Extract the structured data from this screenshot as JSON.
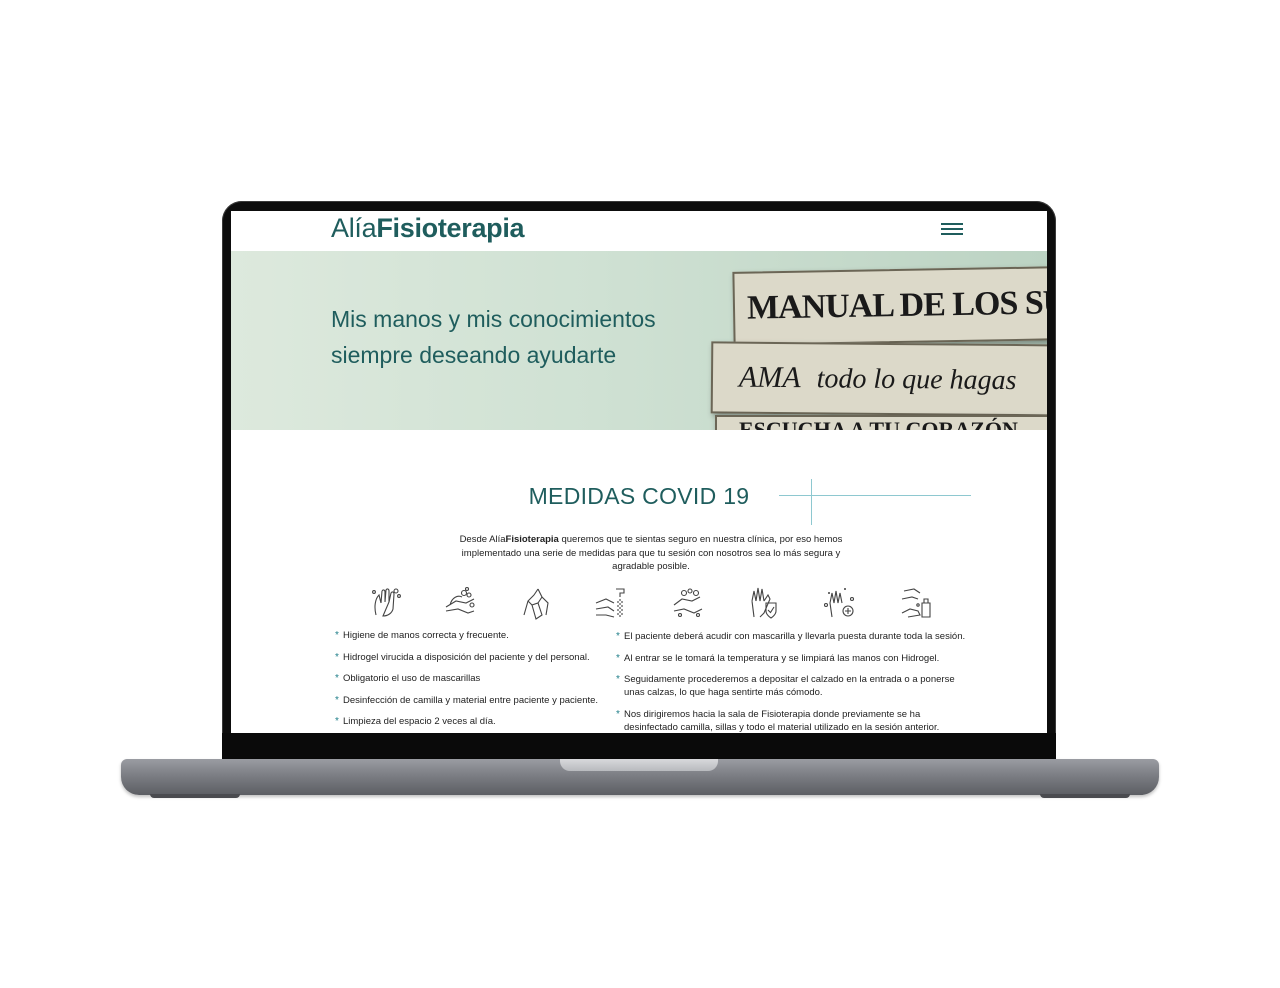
{
  "site": {
    "logo_light": "Alía",
    "logo_bold": "Fisioterapia",
    "menu_icon": "hamburger-menu-icon"
  },
  "hero": {
    "tagline_line1": "Mis manos y mis conocimientos",
    "tagline_line2": "siempre deseando ayudarte",
    "sign_line1": "MANUAL DE LOS SUEÑOS",
    "sign_line2_big": "AMA",
    "sign_line2_small": "todo lo que hagas",
    "sign_line3": "ESCUCHA A TU CORAZÓN"
  },
  "covid": {
    "title": "MEDIDAS COVID 19",
    "intro_before": "Desde Alía",
    "intro_bold": "Fisioterapia",
    "intro_after": " queremos que te sientas seguro en nuestra clínica, por eso hemos implementado una serie de medidas para que tu sesión con nosotros sea lo más segura y agradable posible.",
    "icons": [
      "hand-wash-icon",
      "soap-hands-icon",
      "tissue-hands-icon",
      "faucet-hands-icon",
      "rinse-hands-icon",
      "hand-shield-icon",
      "sanitize-hands-icon",
      "dispenser-hand-icon"
    ],
    "left_items": [
      "Higiene de manos correcta y frecuente.",
      "Hidrogel virucida a disposición del paciente y del personal.",
      "Obligatorio el uso de mascarillas",
      "Desinfección de camilla y material entre paciente y paciente.",
      "Limpieza del espacio 2 veces al día."
    ],
    "right_items": [
      "El paciente deberá acudir con mascarilla y llevarla puesta durante toda la sesión.",
      "Al entrar se le tomará la temperatura y se limpiará las manos con Hidrogel.",
      "Seguidamente procederemos a depositar el calzado en la entrada o a ponerse unas calzas, lo que haga sentirte más cómodo.",
      "Nos dirigiremos hacia la sala de Fisioterapia donde previamente se ha desinfectado camilla, sillas y todo el material utilizado en la sesión anterior."
    ],
    "bullet": "*"
  },
  "colors": {
    "brand": "#1f5d5d",
    "accent_line": "#8ec8d0",
    "bullet": "#1f7f8a"
  }
}
